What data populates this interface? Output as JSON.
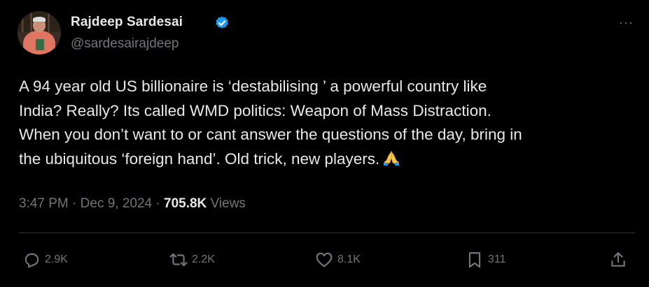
{
  "author": {
    "name": "Rajdeep Sardesai",
    "handle": "@sardesairajdeep",
    "verified": true
  },
  "menu_icon": "more-dots-icon",
  "tweet": {
    "text": "A 94 year old US billionaire is ‘destabilising ’  a powerful country like\nIndia? Really? Its called WMD politics: Weapon of Mass Distraction.\nWhen you don’t want to or cant answer the questions of the day, bring in\nthe ubiquitous ‘foreign hand’. Old trick, new players.",
    "emoji": "folded-hands-emoji"
  },
  "meta": {
    "time": "3:47 PM",
    "date": "Dec 9, 2024",
    "views_count": "705.8K",
    "views_label": "Views",
    "separator": "·"
  },
  "actions": {
    "replies": "2.9K",
    "reposts": "2.2K",
    "likes": "8.1K",
    "bookmarks": "311"
  },
  "colors": {
    "background": "#000000",
    "text": "#e7e9ea",
    "secondary": "#71767b",
    "verified": "#1d9bf0",
    "divider": "#2f3336"
  }
}
